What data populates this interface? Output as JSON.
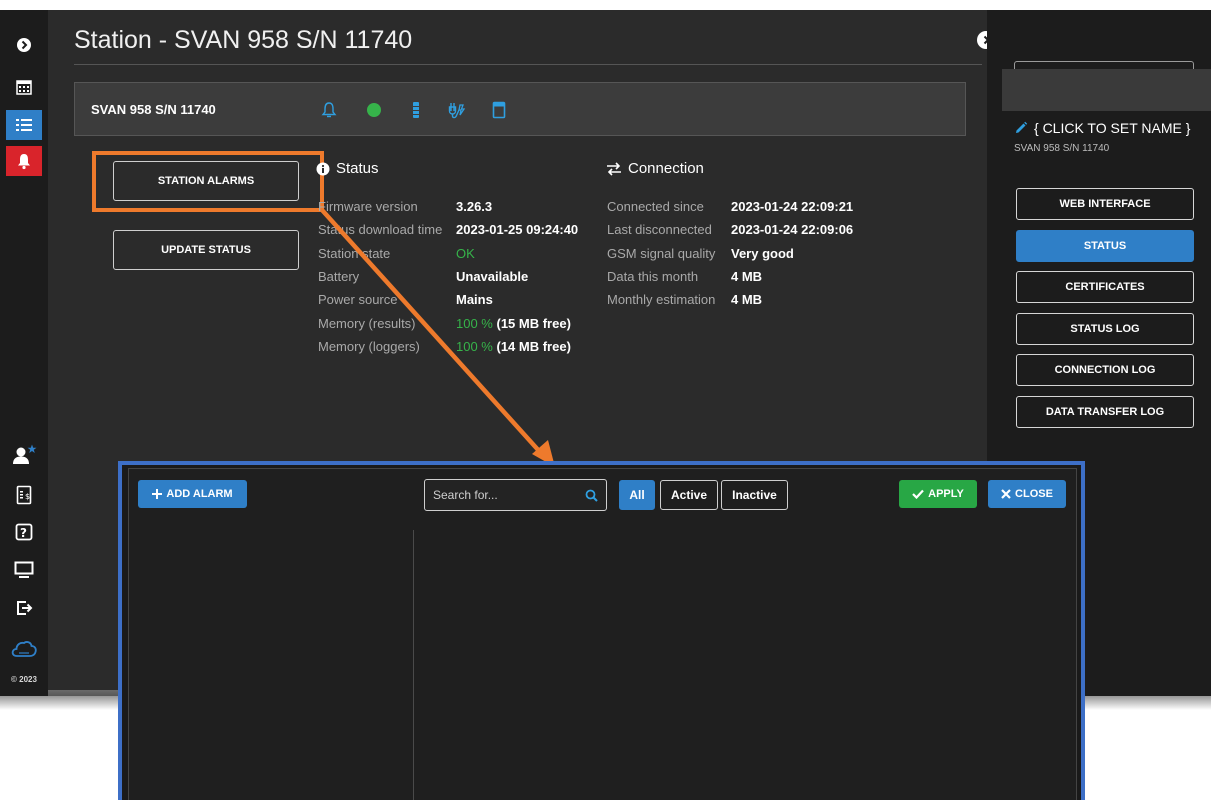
{
  "page": {
    "title": "Station - SVAN 958 S/N 11740",
    "copyright": "© 2023"
  },
  "station_bar": {
    "name": "SVAN 958 S/N 11740"
  },
  "actions": {
    "station_alarms": "STATION ALARMS",
    "update_status": "UPDATE STATUS"
  },
  "status": {
    "heading": "Status",
    "rows": [
      {
        "label": "Firmware version",
        "value": "3.26.3"
      },
      {
        "label": "Status download time",
        "value": "2023-01-25 09:24:40"
      },
      {
        "label": "Station state",
        "value": "OK"
      },
      {
        "label": "Battery",
        "value": "Unavailable"
      },
      {
        "label": "Power source",
        "value": "Mains"
      },
      {
        "label": "Memory (results)",
        "pct": "100 %",
        "value": "(15 MB free)"
      },
      {
        "label": "Memory (loggers)",
        "pct": "100 %",
        "value": "(14 MB free)"
      }
    ]
  },
  "connection": {
    "heading": "Connection",
    "rows": [
      {
        "label": "Connected since",
        "value": "2023-01-24 22:09:21"
      },
      {
        "label": "Last disconnected",
        "value": "2023-01-24 22:09:06"
      },
      {
        "label": "GSM signal quality",
        "value": "Very good"
      },
      {
        "label": "Data this month",
        "value": "4 MB"
      },
      {
        "label": "Monthly estimation",
        "value": "4 MB"
      }
    ]
  },
  "right_panel": {
    "name_prompt": "{ CLICK TO SET NAME }",
    "station_sub": "SVAN 958 S/N 11740",
    "buttons": [
      {
        "label": "WEB INTERFACE"
      },
      {
        "label": "STATUS"
      },
      {
        "label": "CERTIFICATES"
      },
      {
        "label": "STATUS LOG"
      },
      {
        "label": "CONNECTION LOG"
      },
      {
        "label": "DATA TRANSFER LOG"
      }
    ]
  },
  "modal": {
    "add_alarm": "ADD ALARM",
    "search_placeholder": "Search for...",
    "filters": [
      "All",
      "Active",
      "Inactive"
    ],
    "apply": "APPLY",
    "close": "CLOSE"
  },
  "colors": {
    "accent": "#2f7fc7",
    "alert": "#d9242b",
    "ok_green": "#36b34a",
    "highlight_orange": "#ee7a2c",
    "modal_border": "#3d6fc7",
    "apply_green": "#28a745"
  }
}
